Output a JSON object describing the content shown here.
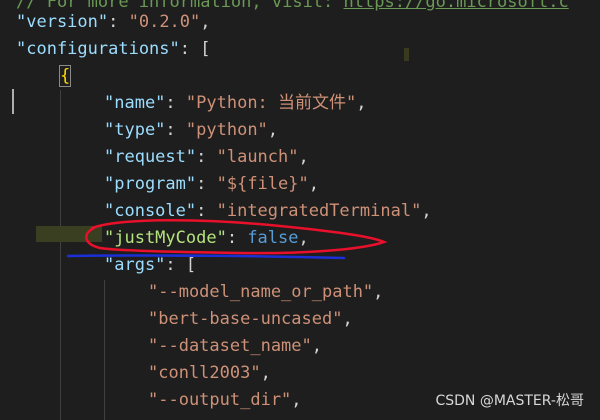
{
  "editor": {
    "comment_prefix": "// For more information, visit: ",
    "comment_link": "https://go.microsoft.c",
    "version_key": "\"version\"",
    "version_value": "\"0.2.0\"",
    "configurations_key": "\"configurations\"",
    "open_bracket": "[",
    "open_brace": "{",
    "name_key": "\"name\"",
    "name_value": "\"Python: 当前文件\"",
    "type_key": "\"type\"",
    "type_value": "\"python\"",
    "request_key": "\"request\"",
    "request_value": "\"launch\"",
    "program_key": "\"program\"",
    "program_value": "\"${file}\"",
    "console_key": "\"console\"",
    "console_value": "\"integratedTerminal\"",
    "justmycode_key": "\"justMyCode\"",
    "justmycode_value": "false",
    "args_key": "\"args\"",
    "args": [
      "\"--model_name_or_path\"",
      "\"bert-base-uncased\"",
      "\"--dataset_name\"",
      "\"conll2003\"",
      "\"--output_dir\""
    ]
  },
  "watermark": "CSDN @MASTER-松哥",
  "colors": {
    "background": "#1e1e1e",
    "json_key": "#9cdcfe",
    "json_string": "#ce9178",
    "json_boolean": "#569cd6",
    "bracket": "#ffd700",
    "annotation_red": "#e8102a",
    "annotation_blue": "#1c2fd6"
  }
}
